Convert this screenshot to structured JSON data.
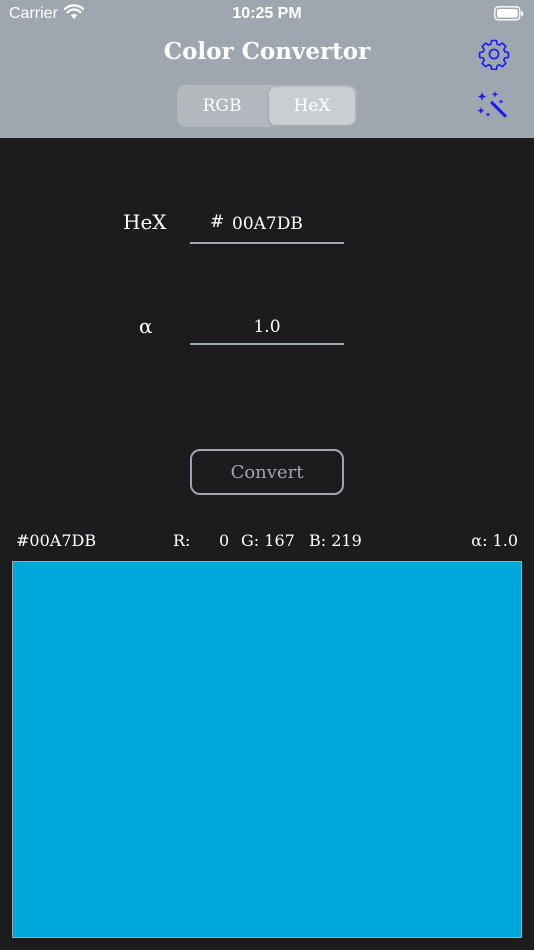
{
  "status_bar": {
    "carrier": "Carrier",
    "time": "10:25 PM"
  },
  "nav": {
    "title": "Color Convertor",
    "tint_color": "#1a1aff",
    "background_color": "#9ea7af"
  },
  "segmented": {
    "options": [
      "RGB",
      "HeX"
    ],
    "selected": "HeX"
  },
  "form": {
    "hex_label": "HeX",
    "hash": "#",
    "hex_value": "00A7DB",
    "alpha_label": "α",
    "alpha_value": "1.0",
    "convert_label": "Convert"
  },
  "result": {
    "hex_text": "#00A7DB",
    "r_label": "R:",
    "r_value": "0",
    "g_text": "G: 167",
    "b_text": "B: 219",
    "alpha_text": "α: 1.0",
    "swatch_color": "#00a7db"
  }
}
